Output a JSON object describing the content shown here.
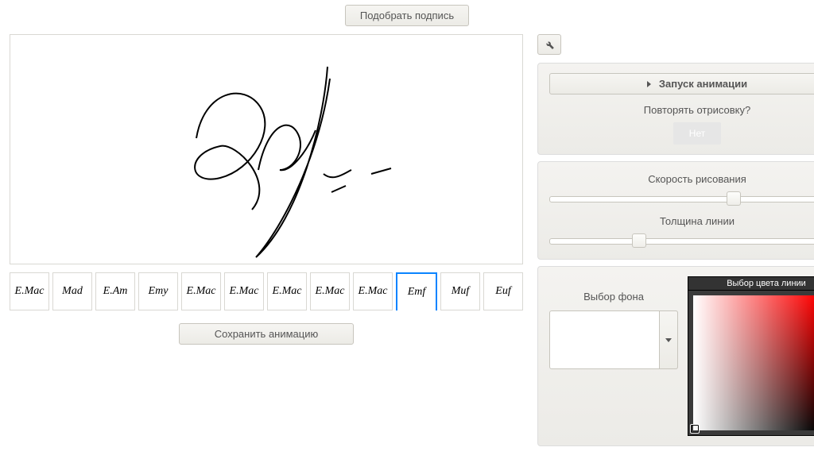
{
  "top": {
    "pick_signature": "Подобрать подпись"
  },
  "left": {
    "save_animation": "Сохранить анимацию",
    "thumbs": [
      "E.Mac",
      "Mad",
      "E.Am",
      "Emy",
      "E.Mac",
      "E.Mac",
      "E.Mac",
      "E.Mac",
      "E.Mac",
      "Emf",
      "Muf",
      "Euf"
    ],
    "selected_thumb": 9
  },
  "panel": {
    "start_animation": "Запуск анимации",
    "repeat_label": "Повторять отрисовку?",
    "repeat_value": "Нет",
    "speed_label": "Скорость рисования",
    "thickness_label": "Толщина линии",
    "speed_pos_pct": 60,
    "thickness_pos_pct": 28
  },
  "color": {
    "bg_label": "Выбор фона",
    "picker_title": "Выбор цвета линии",
    "hue": "#ff0000"
  }
}
